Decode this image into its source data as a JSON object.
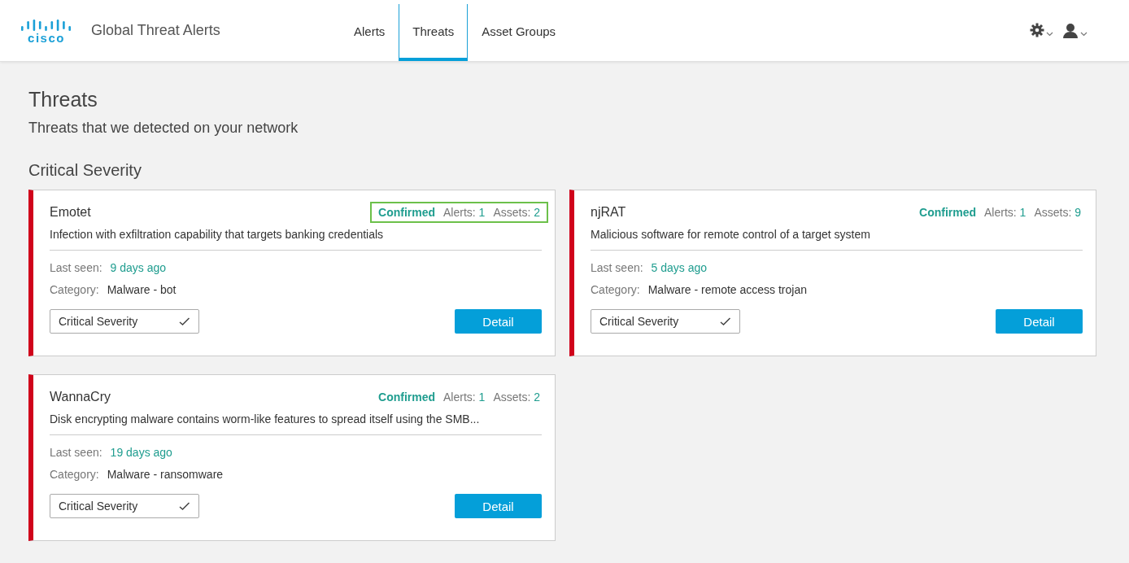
{
  "header": {
    "logo": "cisco",
    "app_title": "Global Threat Alerts",
    "tabs": [
      {
        "label": "Alerts",
        "selected": false
      },
      {
        "label": "Threats",
        "selected": true
      },
      {
        "label": "Asset Groups",
        "selected": false
      }
    ]
  },
  "page": {
    "title": "Threats",
    "subtitle": "Threats that we detected on your network"
  },
  "section": {
    "title": "Critical Severity",
    "cards": [
      {
        "name": "Emotet",
        "status": "Confirmed",
        "alerts_label": "Alerts:",
        "alerts": "1",
        "assets_label": "Assets:",
        "assets": "2",
        "highlighted": true,
        "description": "Infection with exfiltration capability that targets banking credentials",
        "last_seen_label": "Last seen:",
        "last_seen": "9 days ago",
        "category_label": "Category:",
        "category": "Malware - bot",
        "severity": "Critical Severity",
        "button": "Detail"
      },
      {
        "name": "njRAT",
        "status": "Confirmed",
        "alerts_label": "Alerts:",
        "alerts": "1",
        "assets_label": "Assets:",
        "assets": "9",
        "highlighted": false,
        "description": "Malicious software for remote control of a target system",
        "last_seen_label": "Last seen:",
        "last_seen": "5 days ago",
        "category_label": "Category:",
        "category": "Malware - remote access trojan",
        "severity": "Critical Severity",
        "button": "Detail"
      },
      {
        "name": "WannaCry",
        "status": "Confirmed",
        "alerts_label": "Alerts:",
        "alerts": "1",
        "assets_label": "Assets:",
        "assets": "2",
        "highlighted": false,
        "description": "Disk encrypting malware contains worm-like features to spread itself using the SMB...",
        "last_seen_label": "Last seen:",
        "last_seen": "19 days ago",
        "category_label": "Category:",
        "category": "Malware - ransomware",
        "severity": "Critical Severity",
        "button": "Detail"
      }
    ]
  }
}
